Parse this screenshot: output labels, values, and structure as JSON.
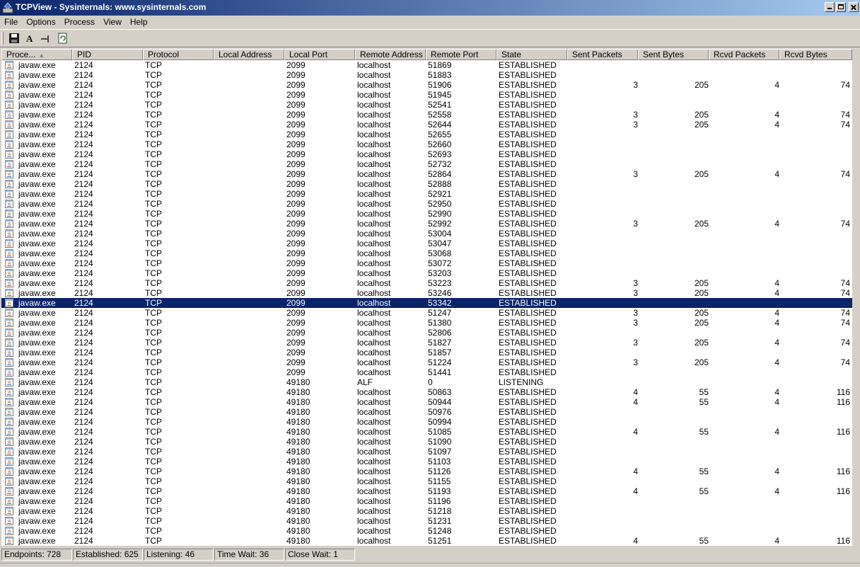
{
  "window": {
    "title": "TCPView - Sysinternals: www.sysinternals.com"
  },
  "menu": [
    "File",
    "Options",
    "Process",
    "View",
    "Help"
  ],
  "toolbar": [
    {
      "name": "save-button",
      "icon": "floppy-disk-icon"
    },
    {
      "name": "resolve-addresses-button",
      "icon": "letter-a-icon"
    },
    {
      "name": "show-unconnected-button",
      "icon": "plug-icon"
    },
    {
      "name": "refresh-button",
      "icon": "refresh-icon"
    }
  ],
  "columns": [
    "Proce...",
    "PID",
    "Protocol",
    "Local Address",
    "Local Port",
    "Remote Address",
    "Remote Port",
    "State",
    "Sent Packets",
    "Sent Bytes",
    "Rcvd Packets",
    "Rcvd Bytes"
  ],
  "sort": {
    "column": "Proce...",
    "icon": "sort-ascending-icon"
  },
  "rows": [
    {
      "process": "javaw.exe",
      "pid": "2124",
      "protocol": "TCP",
      "local_address": "",
      "local_port": "2099",
      "remote_address": "localhost",
      "remote_port": "51869",
      "state": "ESTABLISHED",
      "sent_packets": "",
      "sent_bytes": "",
      "rcvd_packets": "",
      "rcvd_bytes": ""
    },
    {
      "process": "javaw.exe",
      "pid": "2124",
      "protocol": "TCP",
      "local_address": "",
      "local_port": "2099",
      "remote_address": "localhost",
      "remote_port": "51883",
      "state": "ESTABLISHED",
      "sent_packets": "",
      "sent_bytes": "",
      "rcvd_packets": "",
      "rcvd_bytes": ""
    },
    {
      "process": "javaw.exe",
      "pid": "2124",
      "protocol": "TCP",
      "local_address": "",
      "local_port": "2099",
      "remote_address": "localhost",
      "remote_port": "51906",
      "state": "ESTABLISHED",
      "sent_packets": "3",
      "sent_bytes": "205",
      "rcvd_packets": "4",
      "rcvd_bytes": "74"
    },
    {
      "process": "javaw.exe",
      "pid": "2124",
      "protocol": "TCP",
      "local_address": "",
      "local_port": "2099",
      "remote_address": "localhost",
      "remote_port": "51945",
      "state": "ESTABLISHED",
      "sent_packets": "",
      "sent_bytes": "",
      "rcvd_packets": "",
      "rcvd_bytes": ""
    },
    {
      "process": "javaw.exe",
      "pid": "2124",
      "protocol": "TCP",
      "local_address": "",
      "local_port": "2099",
      "remote_address": "localhost",
      "remote_port": "52541",
      "state": "ESTABLISHED",
      "sent_packets": "",
      "sent_bytes": "",
      "rcvd_packets": "",
      "rcvd_bytes": ""
    },
    {
      "process": "javaw.exe",
      "pid": "2124",
      "protocol": "TCP",
      "local_address": "",
      "local_port": "2099",
      "remote_address": "localhost",
      "remote_port": "52558",
      "state": "ESTABLISHED",
      "sent_packets": "3",
      "sent_bytes": "205",
      "rcvd_packets": "4",
      "rcvd_bytes": "74"
    },
    {
      "process": "javaw.exe",
      "pid": "2124",
      "protocol": "TCP",
      "local_address": "",
      "local_port": "2099",
      "remote_address": "localhost",
      "remote_port": "52644",
      "state": "ESTABLISHED",
      "sent_packets": "3",
      "sent_bytes": "205",
      "rcvd_packets": "4",
      "rcvd_bytes": "74"
    },
    {
      "process": "javaw.exe",
      "pid": "2124",
      "protocol": "TCP",
      "local_address": "",
      "local_port": "2099",
      "remote_address": "localhost",
      "remote_port": "52655",
      "state": "ESTABLISHED",
      "sent_packets": "",
      "sent_bytes": "",
      "rcvd_packets": "",
      "rcvd_bytes": ""
    },
    {
      "process": "javaw.exe",
      "pid": "2124",
      "protocol": "TCP",
      "local_address": "",
      "local_port": "2099",
      "remote_address": "localhost",
      "remote_port": "52660",
      "state": "ESTABLISHED",
      "sent_packets": "",
      "sent_bytes": "",
      "rcvd_packets": "",
      "rcvd_bytes": ""
    },
    {
      "process": "javaw.exe",
      "pid": "2124",
      "protocol": "TCP",
      "local_address": "",
      "local_port": "2099",
      "remote_address": "localhost",
      "remote_port": "52693",
      "state": "ESTABLISHED",
      "sent_packets": "",
      "sent_bytes": "",
      "rcvd_packets": "",
      "rcvd_bytes": ""
    },
    {
      "process": "javaw.exe",
      "pid": "2124",
      "protocol": "TCP",
      "local_address": "",
      "local_port": "2099",
      "remote_address": "localhost",
      "remote_port": "52732",
      "state": "ESTABLISHED",
      "sent_packets": "",
      "sent_bytes": "",
      "rcvd_packets": "",
      "rcvd_bytes": ""
    },
    {
      "process": "javaw.exe",
      "pid": "2124",
      "protocol": "TCP",
      "local_address": "",
      "local_port": "2099",
      "remote_address": "localhost",
      "remote_port": "52864",
      "state": "ESTABLISHED",
      "sent_packets": "3",
      "sent_bytes": "205",
      "rcvd_packets": "4",
      "rcvd_bytes": "74"
    },
    {
      "process": "javaw.exe",
      "pid": "2124",
      "protocol": "TCP",
      "local_address": "",
      "local_port": "2099",
      "remote_address": "localhost",
      "remote_port": "52888",
      "state": "ESTABLISHED",
      "sent_packets": "",
      "sent_bytes": "",
      "rcvd_packets": "",
      "rcvd_bytes": ""
    },
    {
      "process": "javaw.exe",
      "pid": "2124",
      "protocol": "TCP",
      "local_address": "",
      "local_port": "2099",
      "remote_address": "localhost",
      "remote_port": "52921",
      "state": "ESTABLISHED",
      "sent_packets": "",
      "sent_bytes": "",
      "rcvd_packets": "",
      "rcvd_bytes": ""
    },
    {
      "process": "javaw.exe",
      "pid": "2124",
      "protocol": "TCP",
      "local_address": "",
      "local_port": "2099",
      "remote_address": "localhost",
      "remote_port": "52950",
      "state": "ESTABLISHED",
      "sent_packets": "",
      "sent_bytes": "",
      "rcvd_packets": "",
      "rcvd_bytes": ""
    },
    {
      "process": "javaw.exe",
      "pid": "2124",
      "protocol": "TCP",
      "local_address": "",
      "local_port": "2099",
      "remote_address": "localhost",
      "remote_port": "52990",
      "state": "ESTABLISHED",
      "sent_packets": "",
      "sent_bytes": "",
      "rcvd_packets": "",
      "rcvd_bytes": ""
    },
    {
      "process": "javaw.exe",
      "pid": "2124",
      "protocol": "TCP",
      "local_address": "",
      "local_port": "2099",
      "remote_address": "localhost",
      "remote_port": "52992",
      "state": "ESTABLISHED",
      "sent_packets": "3",
      "sent_bytes": "205",
      "rcvd_packets": "4",
      "rcvd_bytes": "74"
    },
    {
      "process": "javaw.exe",
      "pid": "2124",
      "protocol": "TCP",
      "local_address": "",
      "local_port": "2099",
      "remote_address": "localhost",
      "remote_port": "53004",
      "state": "ESTABLISHED",
      "sent_packets": "",
      "sent_bytes": "",
      "rcvd_packets": "",
      "rcvd_bytes": ""
    },
    {
      "process": "javaw.exe",
      "pid": "2124",
      "protocol": "TCP",
      "local_address": "",
      "local_port": "2099",
      "remote_address": "localhost",
      "remote_port": "53047",
      "state": "ESTABLISHED",
      "sent_packets": "",
      "sent_bytes": "",
      "rcvd_packets": "",
      "rcvd_bytes": ""
    },
    {
      "process": "javaw.exe",
      "pid": "2124",
      "protocol": "TCP",
      "local_address": "",
      "local_port": "2099",
      "remote_address": "localhost",
      "remote_port": "53068",
      "state": "ESTABLISHED",
      "sent_packets": "",
      "sent_bytes": "",
      "rcvd_packets": "",
      "rcvd_bytes": ""
    },
    {
      "process": "javaw.exe",
      "pid": "2124",
      "protocol": "TCP",
      "local_address": "",
      "local_port": "2099",
      "remote_address": "localhost",
      "remote_port": "53072",
      "state": "ESTABLISHED",
      "sent_packets": "",
      "sent_bytes": "",
      "rcvd_packets": "",
      "rcvd_bytes": ""
    },
    {
      "process": "javaw.exe",
      "pid": "2124",
      "protocol": "TCP",
      "local_address": "",
      "local_port": "2099",
      "remote_address": "localhost",
      "remote_port": "53203",
      "state": "ESTABLISHED",
      "sent_packets": "",
      "sent_bytes": "",
      "rcvd_packets": "",
      "rcvd_bytes": ""
    },
    {
      "process": "javaw.exe",
      "pid": "2124",
      "protocol": "TCP",
      "local_address": "",
      "local_port": "2099",
      "remote_address": "localhost",
      "remote_port": "53223",
      "state": "ESTABLISHED",
      "sent_packets": "3",
      "sent_bytes": "205",
      "rcvd_packets": "4",
      "rcvd_bytes": "74"
    },
    {
      "process": "javaw.exe",
      "pid": "2124",
      "protocol": "TCP",
      "local_address": "",
      "local_port": "2099",
      "remote_address": "localhost",
      "remote_port": "53246",
      "state": "ESTABLISHED",
      "sent_packets": "3",
      "sent_bytes": "205",
      "rcvd_packets": "4",
      "rcvd_bytes": "74"
    },
    {
      "process": "javaw.exe",
      "pid": "2124",
      "protocol": "TCP",
      "local_address": "",
      "local_port": "2099",
      "remote_address": "localhost",
      "remote_port": "53342",
      "state": "ESTABLISHED",
      "sent_packets": "",
      "sent_bytes": "",
      "rcvd_packets": "",
      "rcvd_bytes": "",
      "selected": true
    },
    {
      "process": "javaw.exe",
      "pid": "2124",
      "protocol": "TCP",
      "local_address": "",
      "local_port": "2099",
      "remote_address": "localhost",
      "remote_port": "51247",
      "state": "ESTABLISHED",
      "sent_packets": "3",
      "sent_bytes": "205",
      "rcvd_packets": "4",
      "rcvd_bytes": "74"
    },
    {
      "process": "javaw.exe",
      "pid": "2124",
      "protocol": "TCP",
      "local_address": "",
      "local_port": "2099",
      "remote_address": "localhost",
      "remote_port": "51380",
      "state": "ESTABLISHED",
      "sent_packets": "3",
      "sent_bytes": "205",
      "rcvd_packets": "4",
      "rcvd_bytes": "74"
    },
    {
      "process": "javaw.exe",
      "pid": "2124",
      "protocol": "TCP",
      "local_address": "",
      "local_port": "2099",
      "remote_address": "localhost",
      "remote_port": "52806",
      "state": "ESTABLISHED",
      "sent_packets": "",
      "sent_bytes": "",
      "rcvd_packets": "",
      "rcvd_bytes": ""
    },
    {
      "process": "javaw.exe",
      "pid": "2124",
      "protocol": "TCP",
      "local_address": "",
      "local_port": "2099",
      "remote_address": "localhost",
      "remote_port": "51827",
      "state": "ESTABLISHED",
      "sent_packets": "3",
      "sent_bytes": "205",
      "rcvd_packets": "4",
      "rcvd_bytes": "74"
    },
    {
      "process": "javaw.exe",
      "pid": "2124",
      "protocol": "TCP",
      "local_address": "",
      "local_port": "2099",
      "remote_address": "localhost",
      "remote_port": "51857",
      "state": "ESTABLISHED",
      "sent_packets": "",
      "sent_bytes": "",
      "rcvd_packets": "",
      "rcvd_bytes": ""
    },
    {
      "process": "javaw.exe",
      "pid": "2124",
      "protocol": "TCP",
      "local_address": "",
      "local_port": "2099",
      "remote_address": "localhost",
      "remote_port": "51224",
      "state": "ESTABLISHED",
      "sent_packets": "3",
      "sent_bytes": "205",
      "rcvd_packets": "4",
      "rcvd_bytes": "74"
    },
    {
      "process": "javaw.exe",
      "pid": "2124",
      "protocol": "TCP",
      "local_address": "",
      "local_port": "2099",
      "remote_address": "localhost",
      "remote_port": "51441",
      "state": "ESTABLISHED",
      "sent_packets": "",
      "sent_bytes": "",
      "rcvd_packets": "",
      "rcvd_bytes": ""
    },
    {
      "process": "javaw.exe",
      "pid": "2124",
      "protocol": "TCP",
      "local_address": "",
      "local_port": "49180",
      "remote_address": "ALF",
      "remote_port": "0",
      "state": "LISTENING",
      "sent_packets": "",
      "sent_bytes": "",
      "rcvd_packets": "",
      "rcvd_bytes": ""
    },
    {
      "process": "javaw.exe",
      "pid": "2124",
      "protocol": "TCP",
      "local_address": "",
      "local_port": "49180",
      "remote_address": "localhost",
      "remote_port": "50863",
      "state": "ESTABLISHED",
      "sent_packets": "4",
      "sent_bytes": "55",
      "rcvd_packets": "4",
      "rcvd_bytes": "116"
    },
    {
      "process": "javaw.exe",
      "pid": "2124",
      "protocol": "TCP",
      "local_address": "",
      "local_port": "49180",
      "remote_address": "localhost",
      "remote_port": "50944",
      "state": "ESTABLISHED",
      "sent_packets": "4",
      "sent_bytes": "55",
      "rcvd_packets": "4",
      "rcvd_bytes": "116"
    },
    {
      "process": "javaw.exe",
      "pid": "2124",
      "protocol": "TCP",
      "local_address": "",
      "local_port": "49180",
      "remote_address": "localhost",
      "remote_port": "50976",
      "state": "ESTABLISHED",
      "sent_packets": "",
      "sent_bytes": "",
      "rcvd_packets": "",
      "rcvd_bytes": ""
    },
    {
      "process": "javaw.exe",
      "pid": "2124",
      "protocol": "TCP",
      "local_address": "",
      "local_port": "49180",
      "remote_address": "localhost",
      "remote_port": "50994",
      "state": "ESTABLISHED",
      "sent_packets": "",
      "sent_bytes": "",
      "rcvd_packets": "",
      "rcvd_bytes": ""
    },
    {
      "process": "javaw.exe",
      "pid": "2124",
      "protocol": "TCP",
      "local_address": "",
      "local_port": "49180",
      "remote_address": "localhost",
      "remote_port": "51085",
      "state": "ESTABLISHED",
      "sent_packets": "4",
      "sent_bytes": "55",
      "rcvd_packets": "4",
      "rcvd_bytes": "116"
    },
    {
      "process": "javaw.exe",
      "pid": "2124",
      "protocol": "TCP",
      "local_address": "",
      "local_port": "49180",
      "remote_address": "localhost",
      "remote_port": "51090",
      "state": "ESTABLISHED",
      "sent_packets": "",
      "sent_bytes": "",
      "rcvd_packets": "",
      "rcvd_bytes": ""
    },
    {
      "process": "javaw.exe",
      "pid": "2124",
      "protocol": "TCP",
      "local_address": "",
      "local_port": "49180",
      "remote_address": "localhost",
      "remote_port": "51097",
      "state": "ESTABLISHED",
      "sent_packets": "",
      "sent_bytes": "",
      "rcvd_packets": "",
      "rcvd_bytes": ""
    },
    {
      "process": "javaw.exe",
      "pid": "2124",
      "protocol": "TCP",
      "local_address": "",
      "local_port": "49180",
      "remote_address": "localhost",
      "remote_port": "51103",
      "state": "ESTABLISHED",
      "sent_packets": "",
      "sent_bytes": "",
      "rcvd_packets": "",
      "rcvd_bytes": ""
    },
    {
      "process": "javaw.exe",
      "pid": "2124",
      "protocol": "TCP",
      "local_address": "",
      "local_port": "49180",
      "remote_address": "localhost",
      "remote_port": "51126",
      "state": "ESTABLISHED",
      "sent_packets": "4",
      "sent_bytes": "55",
      "rcvd_packets": "4",
      "rcvd_bytes": "116"
    },
    {
      "process": "javaw.exe",
      "pid": "2124",
      "protocol": "TCP",
      "local_address": "",
      "local_port": "49180",
      "remote_address": "localhost",
      "remote_port": "51155",
      "state": "ESTABLISHED",
      "sent_packets": "",
      "sent_bytes": "",
      "rcvd_packets": "",
      "rcvd_bytes": ""
    },
    {
      "process": "javaw.exe",
      "pid": "2124",
      "protocol": "TCP",
      "local_address": "",
      "local_port": "49180",
      "remote_address": "localhost",
      "remote_port": "51193",
      "state": "ESTABLISHED",
      "sent_packets": "4",
      "sent_bytes": "55",
      "rcvd_packets": "4",
      "rcvd_bytes": "116"
    },
    {
      "process": "javaw.exe",
      "pid": "2124",
      "protocol": "TCP",
      "local_address": "",
      "local_port": "49180",
      "remote_address": "localhost",
      "remote_port": "51196",
      "state": "ESTABLISHED",
      "sent_packets": "",
      "sent_bytes": "",
      "rcvd_packets": "",
      "rcvd_bytes": ""
    },
    {
      "process": "javaw.exe",
      "pid": "2124",
      "protocol": "TCP",
      "local_address": "",
      "local_port": "49180",
      "remote_address": "localhost",
      "remote_port": "51218",
      "state": "ESTABLISHED",
      "sent_packets": "",
      "sent_bytes": "",
      "rcvd_packets": "",
      "rcvd_bytes": ""
    },
    {
      "process": "javaw.exe",
      "pid": "2124",
      "protocol": "TCP",
      "local_address": "",
      "local_port": "49180",
      "remote_address": "localhost",
      "remote_port": "51231",
      "state": "ESTABLISHED",
      "sent_packets": "",
      "sent_bytes": "",
      "rcvd_packets": "",
      "rcvd_bytes": ""
    },
    {
      "process": "javaw.exe",
      "pid": "2124",
      "protocol": "TCP",
      "local_address": "",
      "local_port": "49180",
      "remote_address": "localhost",
      "remote_port": "51248",
      "state": "ESTABLISHED",
      "sent_packets": "",
      "sent_bytes": "",
      "rcvd_packets": "",
      "rcvd_bytes": ""
    },
    {
      "process": "javaw.exe",
      "pid": "2124",
      "protocol": "TCP",
      "local_address": "",
      "local_port": "49180",
      "remote_address": "localhost",
      "remote_port": "51251",
      "state": "ESTABLISHED",
      "sent_packets": "4",
      "sent_bytes": "55",
      "rcvd_packets": "4",
      "rcvd_bytes": "116"
    }
  ],
  "status": [
    "Endpoints: 728",
    "Established: 625",
    "Listening: 46",
    "Time Wait: 36",
    "Close Wait: 1"
  ],
  "colors": {
    "selection": "#0a246a",
    "chrome": "#d4d0c8",
    "titlebar_start": "#0a246a",
    "titlebar_end": "#a6caf0"
  }
}
